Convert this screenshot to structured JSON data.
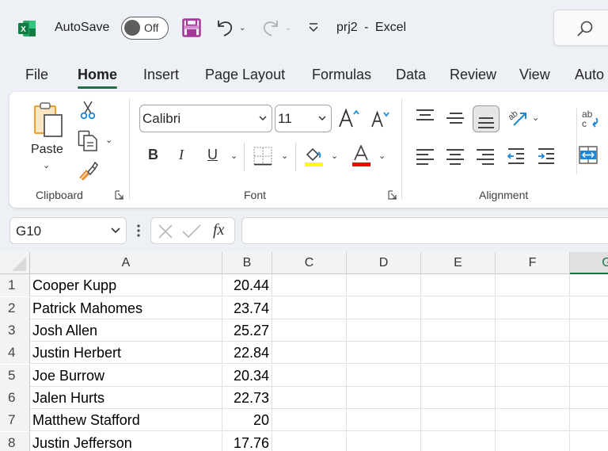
{
  "titlebar": {
    "autosave_label": "AutoSave",
    "autosave_state": "Off",
    "doc_title": "prj2 - Excel",
    "icons": [
      "excel-logo-icon",
      "save-icon",
      "undo-icon",
      "redo-icon",
      "customize-qat-icon",
      "search-icon"
    ]
  },
  "tabs": [
    {
      "label": "File"
    },
    {
      "label": "Home",
      "active": true
    },
    {
      "label": "Insert"
    },
    {
      "label": "Page Layout"
    },
    {
      "label": "Formulas"
    },
    {
      "label": "Data"
    },
    {
      "label": "Review"
    },
    {
      "label": "View"
    },
    {
      "label": "Auto"
    }
  ],
  "ribbon": {
    "clipboard": {
      "label": "Clipboard",
      "paste_label": "Paste"
    },
    "font": {
      "label": "Font",
      "font_name": "Calibri",
      "font_size": "11",
      "bold": "B",
      "italic": "I",
      "underline": "U",
      "highlight_color": "#ffff00",
      "font_color": "#ff0000"
    },
    "alignment": {
      "label": "Alignment"
    }
  },
  "formula_bar": {
    "name_box": "G10",
    "fx": "fx",
    "formula": ""
  },
  "grid": {
    "columns": [
      "A",
      "B",
      "C",
      "D",
      "E",
      "F",
      "G"
    ],
    "selected_column": "G",
    "rows": [
      {
        "num": "1",
        "a": "Cooper Kupp",
        "b": "20.44"
      },
      {
        "num": "2",
        "a": "Patrick Mahomes",
        "b": "23.74"
      },
      {
        "num": "3",
        "a": "Josh Allen",
        "b": "25.27"
      },
      {
        "num": "4",
        "a": "Justin Herbert",
        "b": "22.84"
      },
      {
        "num": "5",
        "a": "Joe Burrow",
        "b": "20.34"
      },
      {
        "num": "6",
        "a": "Jalen Hurts",
        "b": "22.73"
      },
      {
        "num": "7",
        "a": "Matthew Stafford",
        "b": "20"
      },
      {
        "num": "8",
        "a": "Justin Jefferson",
        "b": "17.76"
      }
    ]
  },
  "colors": {
    "accent": "#1e7145",
    "save_icon": "#a4399a",
    "ribbon_blue": "#1e88d6"
  }
}
